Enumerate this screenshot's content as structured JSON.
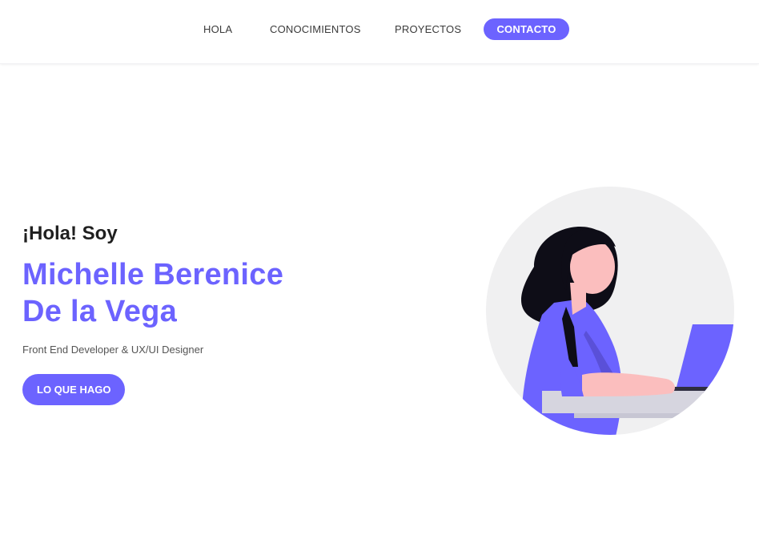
{
  "nav": {
    "items": [
      "HOLA",
      "CONOCIMIENTOS",
      "PROYECTOS"
    ],
    "contact": "CONTACTO"
  },
  "hero": {
    "greeting": "¡Hola! Soy",
    "name_line1": "Michelle Berenice",
    "name_line2": "De la Vega",
    "role": "Front End Developer & UX/UI Designer",
    "cta": "LO QUE HAGO"
  },
  "colors": {
    "accent": "#6c63ff",
    "text": "#1f1f1f",
    "circle_bg": "#f0f0f1"
  },
  "illustration": {
    "icon": "woman-working-on-laptop-illustration"
  }
}
